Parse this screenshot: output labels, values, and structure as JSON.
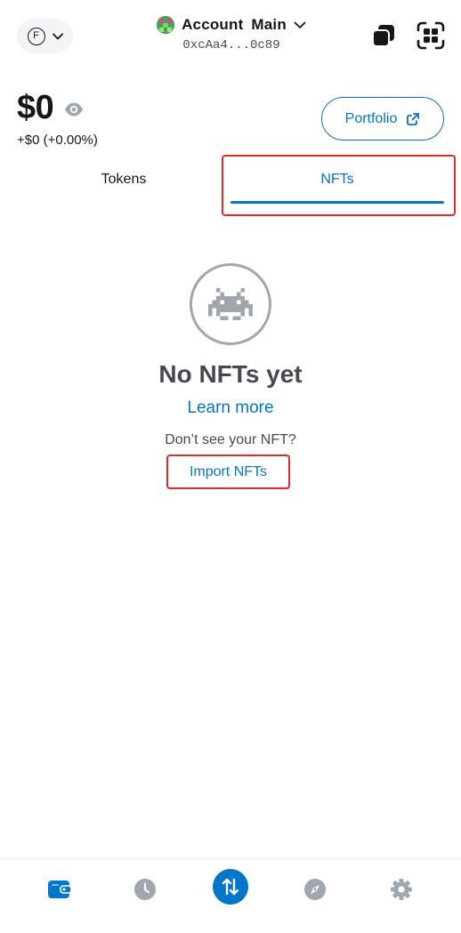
{
  "header": {
    "network_badge": "F",
    "account_name": "Account  Main",
    "account_address": "0xcAa4...0c89"
  },
  "balance": {
    "amount": "$0",
    "change": "+$0 (+0.00%)",
    "portfolio_label": "Portfolio"
  },
  "tabs": [
    {
      "label": "Tokens",
      "active": false
    },
    {
      "label": "NFTs",
      "active": true
    }
  ],
  "empty_state": {
    "title": "No NFTs yet",
    "learn_more": "Learn more",
    "prompt": "Don’t see your NFT?",
    "import_label": "Import NFTs"
  },
  "bottom_nav": [
    {
      "icon": "wallet-icon",
      "active": true
    },
    {
      "icon": "clock-icon",
      "active": false
    },
    {
      "icon": "swap-icon",
      "active": false
    },
    {
      "icon": "compass-icon",
      "active": false
    },
    {
      "icon": "gear-icon",
      "active": false
    }
  ],
  "colors": {
    "accent": "#0376c9",
    "highlight": "#e32a2a",
    "muted_icon": "#9fa6ae",
    "text_primary": "#141618",
    "text_secondary": "#454a52"
  }
}
